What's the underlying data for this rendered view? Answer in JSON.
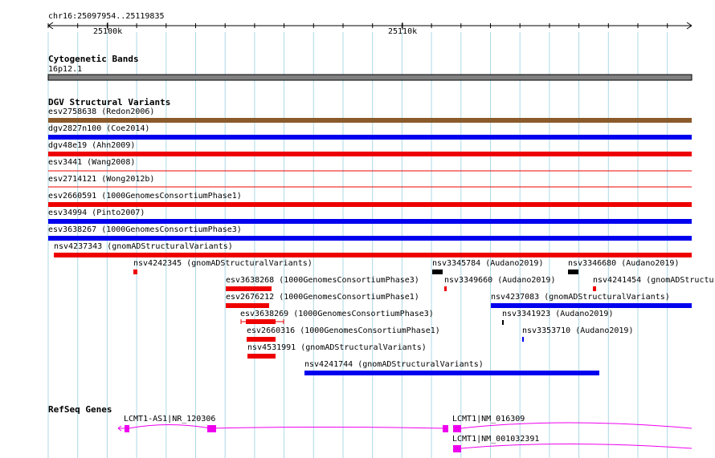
{
  "locus": "chr16:25097954..25119835",
  "ticks": [
    {
      "label": "25100k"
    },
    {
      "label": "25110k"
    }
  ],
  "tracks": {
    "cyto": {
      "title": "Cytogenetic Bands",
      "band": "16p12.1"
    },
    "dgv": {
      "title": "DGV Structural Variants"
    },
    "refseq": {
      "title": "RefSeq Genes"
    }
  },
  "dgv_rows": [
    {
      "label": "esv2758638 (Redon2006)",
      "color": "#8b5a2b"
    },
    {
      "label": "dgv2827n100 (Coe2014)",
      "color": "#0000ee"
    },
    {
      "label": "dgv48e19 (Ahn2009)",
      "color": "#ee0000"
    },
    {
      "label": "esv3441 (Wang2008)",
      "color": "#ee0000"
    },
    {
      "label": "esv2714121 (Wong2012b)",
      "color": "#ee0000"
    },
    {
      "label": "esv2660591 (1000GenomesConsortiumPhase1)",
      "color": "#ee0000"
    },
    {
      "label": "esv34994 (Pinto2007)",
      "color": "#0000ee"
    },
    {
      "label": "esv3638267 (1000GenomesConsortiumPhase3)",
      "color": "#0000ee"
    },
    {
      "label": "nsv4237343 (gnomADStructuralVariants)",
      "color": "#ee0000"
    }
  ],
  "dgv_features": [
    {
      "label": "nsv4242345 (gnomADStructuralVariants)",
      "color": "#ee0000"
    },
    {
      "label": "esv3638268 (1000GenomesConsortiumPhase3)",
      "color": "#ee0000"
    },
    {
      "label": "esv2676212 (1000GenomesConsortiumPhase1)",
      "color": "#ee0000"
    },
    {
      "label": "esv3638269 (1000GenomesConsortiumPhase3)",
      "color": "#ee0000"
    },
    {
      "label": "esv2660316 (1000GenomesConsortiumPhase1)",
      "color": "#ee0000"
    },
    {
      "label": "nsv4531991 (gnomADStructuralVariants)",
      "color": "#ee0000"
    },
    {
      "label": "nsv4241744 (gnomADStructuralVariants)",
      "color": "#0000ee"
    },
    {
      "label": "nsv3345784 (Audano2019)",
      "color": "#000000"
    },
    {
      "label": "nsv3349660 (Audano2019)",
      "color": "#ee0000"
    },
    {
      "label": "nsv3346680 (Audano2019)",
      "color": "#000000"
    },
    {
      "label": "nsv4241454 (gnomADStructu",
      "color": "#ee0000"
    },
    {
      "label": "nsv4237083 (gnomADStructuralVariants)",
      "color": "#0000ee"
    },
    {
      "label": "nsv3341923 (Audano2019)",
      "color": "#000000"
    },
    {
      "label": "nsv3353710 (Audano2019)",
      "color": "#0000ee"
    }
  ],
  "genes": [
    {
      "label": "LCMT1-AS1|NR_120306",
      "color": "#ee00ee"
    },
    {
      "label": "LCMT1|NM_016309",
      "color": "#ee00ee"
    },
    {
      "label": "LCMT1|NM_001032391",
      "color": "#ee00ee"
    }
  ],
  "colors": {
    "grid": "#add8e6",
    "cyto_band": "#808080",
    "gene": "#ee00ee"
  }
}
